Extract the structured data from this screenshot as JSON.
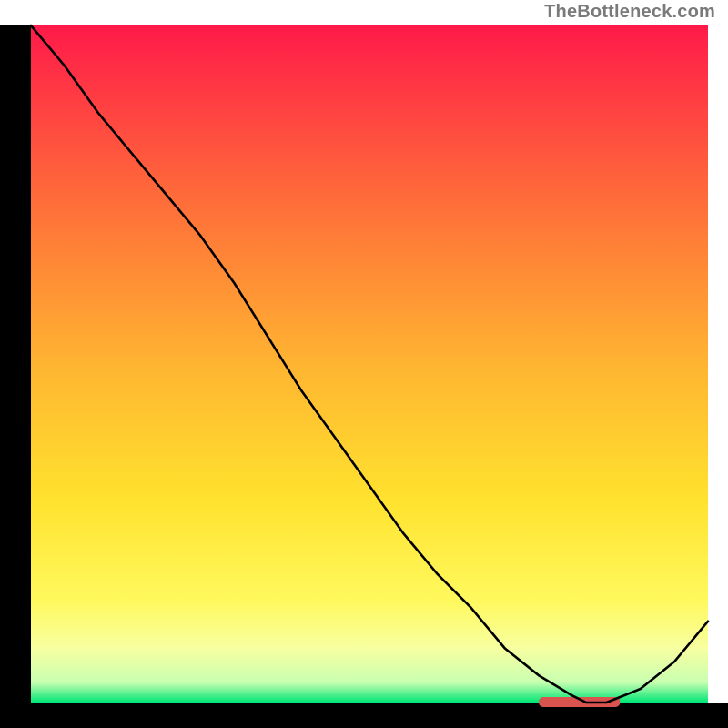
{
  "attribution": "TheBottleneck.com",
  "chart_data": {
    "type": "line",
    "title": "",
    "xlabel": "",
    "ylabel": "",
    "xlim": [
      0,
      100
    ],
    "ylim": [
      0,
      100
    ],
    "x": [
      0,
      5,
      10,
      15,
      20,
      25,
      30,
      35,
      40,
      45,
      50,
      55,
      60,
      65,
      70,
      75,
      80,
      82,
      85,
      90,
      95,
      100
    ],
    "y": [
      100,
      94,
      87,
      81,
      75,
      69,
      62,
      54,
      46,
      39,
      32,
      25,
      19,
      14,
      8,
      4,
      1,
      0,
      0,
      2,
      6,
      12
    ],
    "annotations": [
      {
        "type": "marker-bar",
        "color": "#d9534f",
        "x": [
          75,
          87
        ],
        "y": 0
      }
    ],
    "background": {
      "type": "vertical-gradient",
      "stops": [
        {
          "offset": 0.0,
          "color": "#ff1a49"
        },
        {
          "offset": 0.25,
          "color": "#ff6a3a"
        },
        {
          "offset": 0.5,
          "color": "#ffb431"
        },
        {
          "offset": 0.7,
          "color": "#ffe22e"
        },
        {
          "offset": 0.85,
          "color": "#fff95e"
        },
        {
          "offset": 0.92,
          "color": "#f7ffa0"
        },
        {
          "offset": 0.97,
          "color": "#c9ffb0"
        },
        {
          "offset": 1.0,
          "color": "#00e676"
        }
      ]
    }
  }
}
